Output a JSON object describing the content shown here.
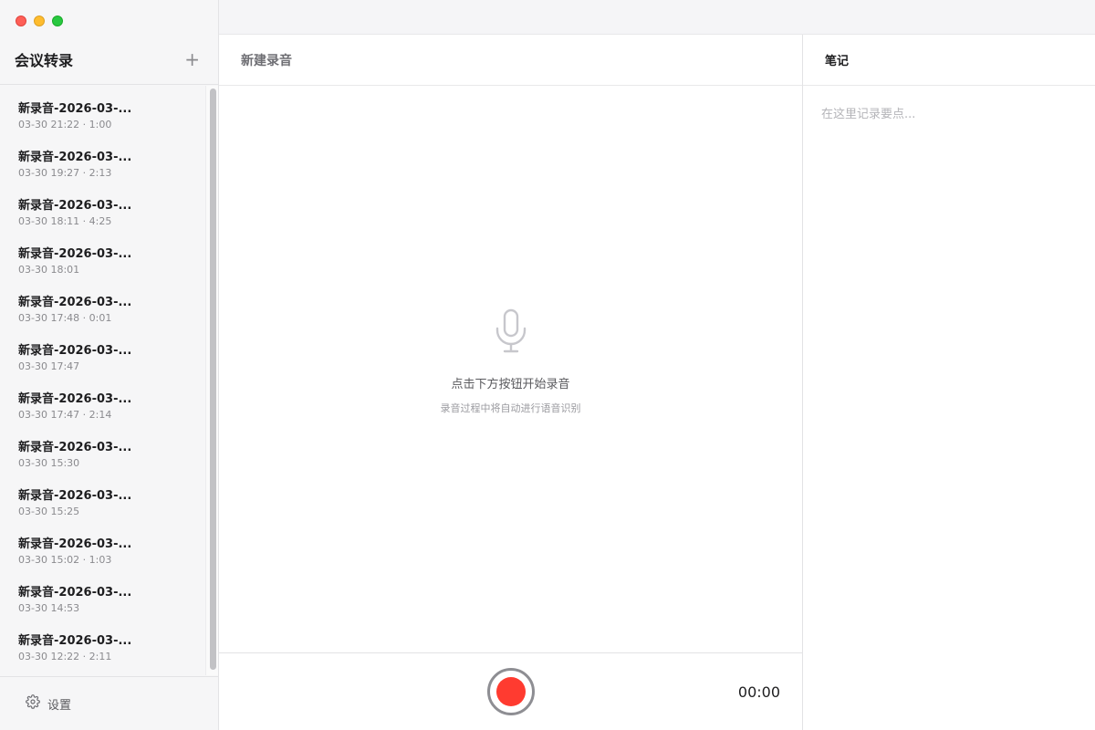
{
  "sidebar": {
    "title": "会议转录",
    "add_label": "+",
    "items": [
      {
        "title": "新录音-2026-03-...",
        "meta": "03-30 21:22 · 1:00"
      },
      {
        "title": "新录音-2026-03-...",
        "meta": "03-30 19:27 · 2:13"
      },
      {
        "title": "新录音-2026-03-...",
        "meta": "03-30 18:11 · 4:25"
      },
      {
        "title": "新录音-2026-03-...",
        "meta": "03-30 18:01"
      },
      {
        "title": "新录音-2026-03-...",
        "meta": "03-30 17:48 · 0:01"
      },
      {
        "title": "新录音-2026-03-...",
        "meta": "03-30 17:47"
      },
      {
        "title": "新录音-2026-03-...",
        "meta": "03-30 17:47 · 2:14"
      },
      {
        "title": "新录音-2026-03-...",
        "meta": "03-30 15:30"
      },
      {
        "title": "新录音-2026-03-...",
        "meta": "03-30 15:25"
      },
      {
        "title": "新录音-2026-03-...",
        "meta": "03-30 15:02 · 1:03"
      },
      {
        "title": "新录音-2026-03-...",
        "meta": "03-30 14:53"
      },
      {
        "title": "新录音-2026-03-...",
        "meta": "03-30 12:22 · 2:11"
      }
    ],
    "settings_label": "设置",
    "settings_icon": "gear-icon"
  },
  "center": {
    "title": "新建录音",
    "empty_icon": "microphone-icon",
    "empty_title": "点击下方按钮开始录音",
    "empty_subtitle": "录音过程中将自动进行语音识别",
    "timer": "00:00",
    "record_color": "#ff3b30"
  },
  "notes": {
    "title": "笔记",
    "placeholder": "在这里记录要点..."
  }
}
